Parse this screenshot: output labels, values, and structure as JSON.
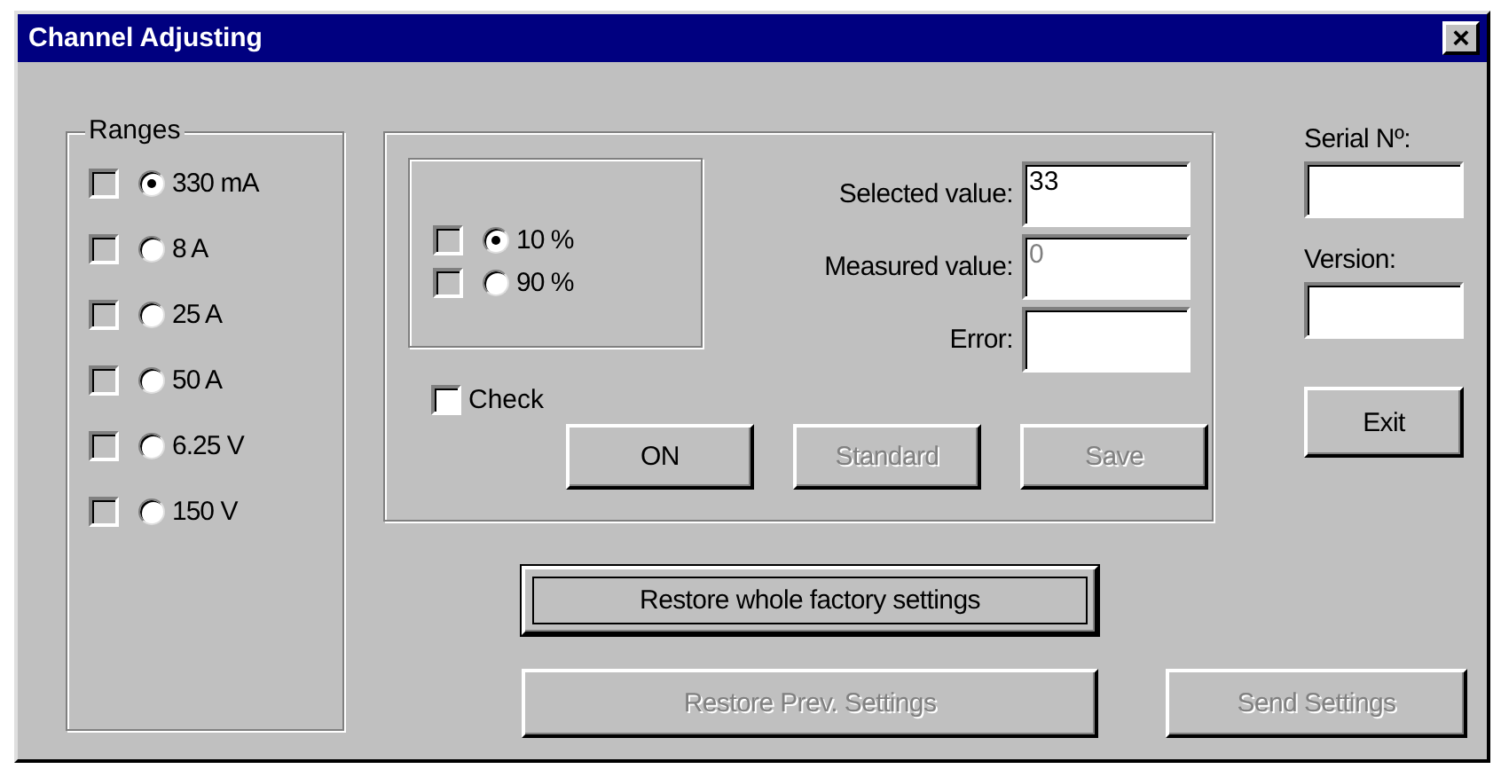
{
  "window": {
    "title": "Channel Adjusting",
    "close": "×"
  },
  "ranges": {
    "title": "Ranges",
    "items": [
      {
        "label": "330 mA",
        "selected": true,
        "checked": false,
        "disabled": true
      },
      {
        "label": "8 A",
        "selected": false,
        "checked": false,
        "disabled": true
      },
      {
        "label": "25 A",
        "selected": false,
        "checked": false,
        "disabled": true
      },
      {
        "label": "50 A",
        "selected": false,
        "checked": false,
        "disabled": true
      },
      {
        "label": "6.25 V",
        "selected": false,
        "checked": false,
        "disabled": true
      },
      {
        "label": "150 V",
        "selected": false,
        "checked": false,
        "disabled": true
      }
    ]
  },
  "percent": [
    {
      "label": "10 %",
      "selected": true,
      "checked": false,
      "disabled": true
    },
    {
      "label": "90 %",
      "selected": false,
      "checked": false,
      "disabled": true
    }
  ],
  "fields": [
    {
      "label": "Selected value:",
      "value": "33"
    },
    {
      "label": "Measured value:",
      "value": "0",
      "disabled": true
    },
    {
      "label": "Error:"
    }
  ],
  "check": {
    "label": "Check",
    "checked": false,
    "disabled": false
  },
  "panel_buttons": [
    {
      "label": "ON",
      "disabled": false
    },
    {
      "label": "Standard",
      "disabled": true
    },
    {
      "label": "Save",
      "disabled": true
    }
  ],
  "serial": {
    "label": "Serial Nº:"
  },
  "version": {
    "label": "Version:"
  },
  "exit": {
    "label": "Exit",
    "disabled": false
  },
  "restore_factory": {
    "label": "Restore whole factory settings",
    "disabled": false,
    "focused": true
  },
  "restore_prev": {
    "label": "Restore Prev. Settings",
    "disabled": true
  },
  "send": {
    "label": "Send Settings",
    "disabled": true
  }
}
